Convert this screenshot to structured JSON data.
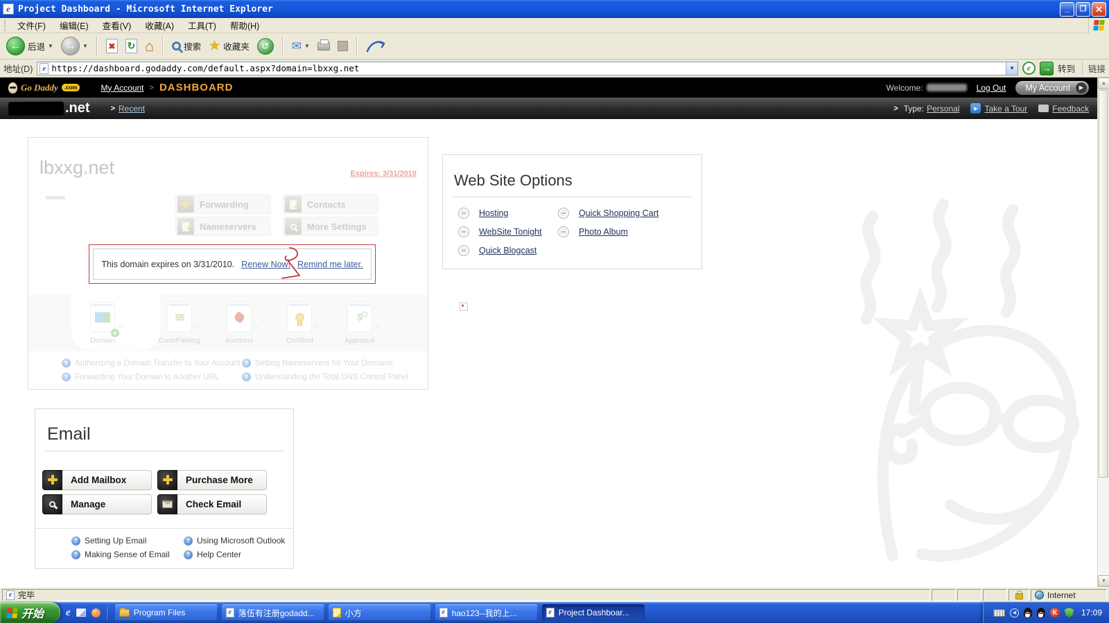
{
  "window": {
    "title": "Project Dashboard - Microsoft Internet Explorer"
  },
  "menu": {
    "items": [
      "文件(F)",
      "编辑(E)",
      "查看(V)",
      "收藏(A)",
      "工具(T)",
      "帮助(H)"
    ]
  },
  "toolbar": {
    "back_label": "后退",
    "search_label": "搜索",
    "favorites_label": "收藏夹"
  },
  "address": {
    "label": "地址(D)",
    "url": "https://dashboard.godaddy.com/default.aspx?domain=lbxxg.net",
    "go_label": "转到",
    "links_label": "链接"
  },
  "godaddy_header": {
    "logo_text": "Go Daddy",
    "logo_com": ".com",
    "my_account_link": "My Account",
    "breadcrumb_sep": ">",
    "dashboard": "DASHBOARD",
    "welcome_label": "Welcome:",
    "log_out": "Log Out",
    "my_account_button": "My Account"
  },
  "domain_bar": {
    "domain_suffix": ".net",
    "recent_link": "Recent",
    "type_label": "Type:",
    "type_value": "Personal",
    "take_a_tour": "Take a Tour",
    "feedback": "Feedback"
  },
  "domain_card": {
    "domain_name": "lbxxg.net",
    "expires_label": "Expires: 3/31/2010",
    "buttons": [
      {
        "label": "Forwarding"
      },
      {
        "label": "Contacts"
      },
      {
        "label": "Nameservers"
      },
      {
        "label": "More Settings"
      }
    ],
    "warning": {
      "message": "This domain expires on 3/31/2010.",
      "renew_link": "Renew Now!",
      "remind_link": "Remind me later."
    },
    "tabs": [
      {
        "label": "Domain"
      },
      {
        "label": "CashParking"
      },
      {
        "label": "Auctions"
      },
      {
        "label": "Certified"
      },
      {
        "label": "Appraisal"
      }
    ],
    "help_links": [
      "Authorizing a Domain Transfer to Your Account",
      "Setting Nameservers for Your Domains",
      "Forwarding Your Domain to Another URL",
      "Understanding the Total DNS Control Panel"
    ]
  },
  "website_options": {
    "title": "Web Site Options",
    "links": [
      "Hosting",
      "Quick Shopping Cart",
      "WebSite Tonight",
      "Photo Album",
      "Quick Blogcast"
    ]
  },
  "email": {
    "title": "Email",
    "buttons": [
      {
        "label": "Add Mailbox"
      },
      {
        "label": "Purchase More"
      },
      {
        "label": "Manage"
      },
      {
        "label": "Check Email"
      }
    ],
    "help_links": [
      "Setting Up Email",
      "Using Microsoft Outlook",
      "Making Sense of Email",
      "Help Center"
    ]
  },
  "status_bar": {
    "status": "完毕",
    "zone": "Internet"
  },
  "taskbar": {
    "start_label": "开始",
    "buttons": [
      {
        "label": "Program Files"
      },
      {
        "label": "落伍有注册godadd..."
      },
      {
        "label": "小方"
      },
      {
        "label": "hao123--我的上..."
      },
      {
        "label": "Project Dashboar..."
      }
    ],
    "time": "17:09"
  },
  "icons": {
    "ie_e": "e",
    "minimize": "_",
    "restore": "❐",
    "close": "✕",
    "back_arrow": "←",
    "forward_arrow": "→",
    "dropdown": "▼",
    "stop_x": "✖",
    "refresh": "↻",
    "home": "⌂",
    "favorites_star": "★",
    "history": "↺",
    "mail_envelope": "✉",
    "go_arrow": "→",
    "shield_e": "e",
    "gt": ">",
    "play": "▶",
    "question_mark": "?",
    "minus": "–",
    "check": "✔",
    "up_arrow": "▲",
    "down_arrow": "▼",
    "left_chevron": "◀",
    "dollar_double": "$$",
    "dollar": "$",
    "k_letter": "K"
  },
  "colors": {
    "titlebar_blue": "#1656da",
    "taskbar_blue": "#2258cc",
    "godaddy_orange": "#f0a43c",
    "warning_border_red": "#c43b3b",
    "link_blue": "#3a5a99",
    "expires_red": "#f0a0a0",
    "chrome_beige": "#ece9d8"
  }
}
